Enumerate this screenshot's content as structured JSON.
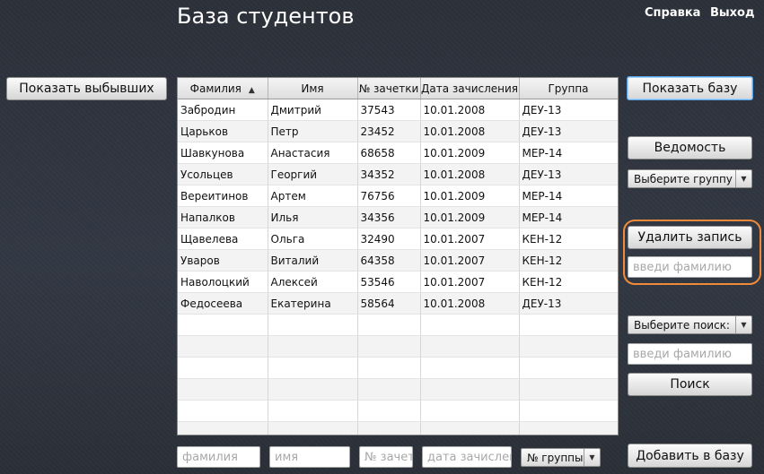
{
  "header": {
    "title": "База студентов",
    "help_link": "Справка",
    "exit_link": "Выход"
  },
  "left": {
    "show_dropped_button": "Показать выбывших"
  },
  "table": {
    "columns": [
      "Фамилия",
      "Имя",
      "№ зачетки",
      "Дата зачисления",
      "Группа"
    ],
    "sorted_column": "Фамилия",
    "sort_direction": "ascending",
    "rows": [
      [
        "Забродин",
        "Дмитрий",
        "37543",
        "10.01.2008",
        "ДЕУ-13"
      ],
      [
        "Царьков",
        "Петр",
        "23452",
        "10.01.2008",
        "ДЕУ-13"
      ],
      [
        "Шавкунова",
        "Анастасия",
        "68658",
        "10.01.2009",
        "МЕР-14"
      ],
      [
        "Усольцев",
        "Георгий",
        "34352",
        "10.01.2008",
        "ДЕУ-13"
      ],
      [
        "Вереитинов",
        "Артем",
        "76756",
        "10.01.2009",
        "МЕР-14"
      ],
      [
        "Напалков",
        "Илья",
        "34356",
        "10.01.2009",
        "МЕР-14"
      ],
      [
        "Щавелева",
        "Ольга",
        "32490",
        "10.01.2007",
        "КЕН-12"
      ],
      [
        "Уваров",
        "Виталий",
        "64358",
        "10.01.2007",
        "КЕН-12"
      ],
      [
        "Наволоцкий",
        "Алексей",
        "53546",
        "10.01.2007",
        "КЕН-12"
      ],
      [
        "Федосеева",
        "Екатерина",
        "58564",
        "10.01.2008",
        "ДЕУ-13"
      ]
    ]
  },
  "right": {
    "show_base_button": "Показать базу",
    "report_button": "Ведомость",
    "group_select": "Выберите группу",
    "delete_button": "Удалить запись",
    "delete_input_placeholder": "введи фамилию",
    "search_select": "Выберите поиск:",
    "search_input_placeholder": "введи фамилию",
    "search_button": "Поиск",
    "add_button": "Добавить в базу"
  },
  "add_form": {
    "surname_placeholder": "фамилия",
    "name_placeholder": "имя",
    "record_book_placeholder": "№ зачетки",
    "date_placeholder": "дата зачисления",
    "group_select": "№ группы"
  },
  "colors": {
    "highlight": "#f08a3a",
    "primary_border": "#5aa5e8"
  }
}
